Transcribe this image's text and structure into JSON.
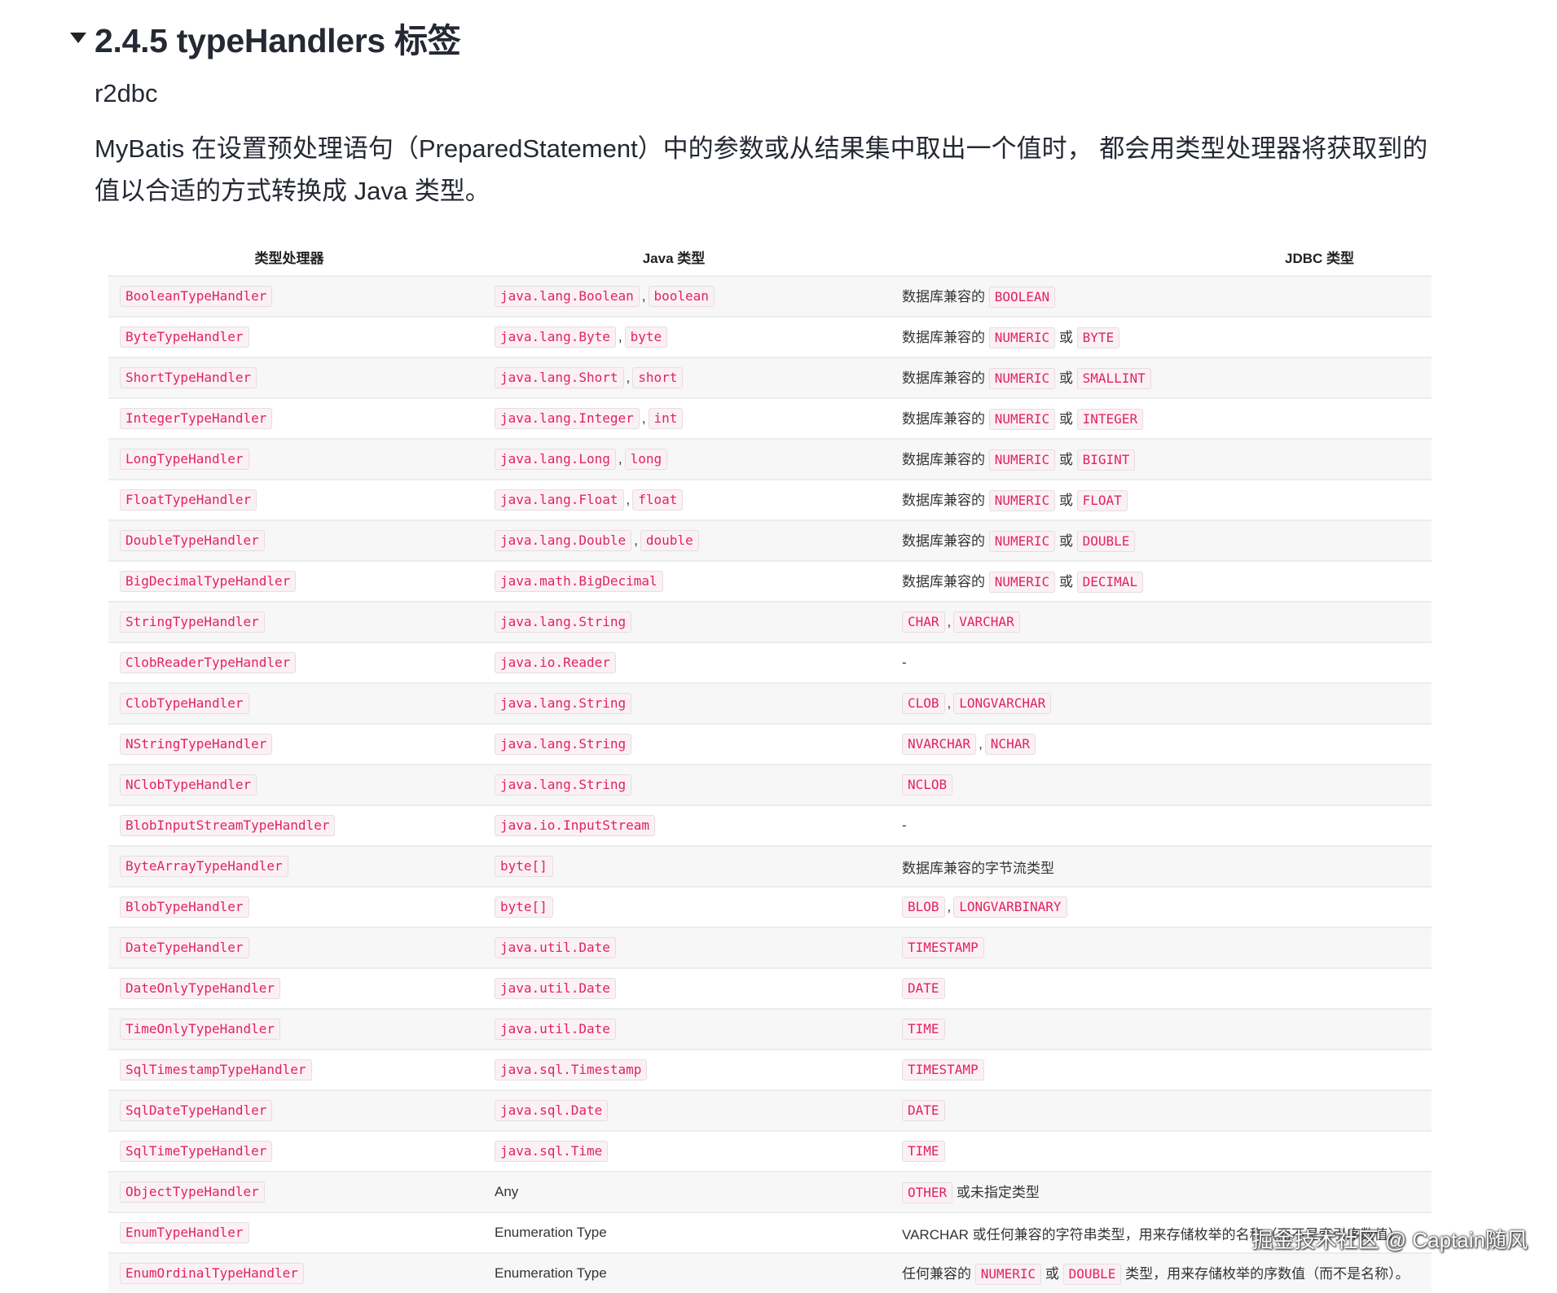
{
  "heading": {
    "title": "2.4.5 typeHandlers 标签"
  },
  "paragraphs": [
    "r2dbc",
    "MyBatis 在设置预处理语句（PreparedStatement）中的参数或从结果集中取出一个值时， 都会用类型处理器将获取到的值以合适的方式转换成 Java 类型。"
  ],
  "table": {
    "headers": [
      "类型处理器",
      "Java 类型",
      "JDBC 类型"
    ],
    "rows": [
      {
        "handler": "BooleanTypeHandler",
        "java": [
          [
            "code",
            "java.lang.Boolean"
          ],
          [
            "sep",
            ","
          ],
          [
            "code",
            "boolean"
          ]
        ],
        "jdbc": [
          [
            "text",
            "数据库兼容的"
          ],
          [
            "code",
            "BOOLEAN"
          ]
        ]
      },
      {
        "handler": "ByteTypeHandler",
        "java": [
          [
            "code",
            "java.lang.Byte"
          ],
          [
            "sep",
            ","
          ],
          [
            "code",
            "byte"
          ]
        ],
        "jdbc": [
          [
            "text",
            "数据库兼容的"
          ],
          [
            "code",
            "NUMERIC"
          ],
          [
            "text",
            "或"
          ],
          [
            "code",
            "BYTE"
          ]
        ]
      },
      {
        "handler": "ShortTypeHandler",
        "java": [
          [
            "code",
            "java.lang.Short"
          ],
          [
            "sep",
            ","
          ],
          [
            "code",
            "short"
          ]
        ],
        "jdbc": [
          [
            "text",
            "数据库兼容的"
          ],
          [
            "code",
            "NUMERIC"
          ],
          [
            "text",
            "或"
          ],
          [
            "code",
            "SMALLINT"
          ]
        ]
      },
      {
        "handler": "IntegerTypeHandler",
        "java": [
          [
            "code",
            "java.lang.Integer"
          ],
          [
            "sep",
            ","
          ],
          [
            "code",
            "int"
          ]
        ],
        "jdbc": [
          [
            "text",
            "数据库兼容的"
          ],
          [
            "code",
            "NUMERIC"
          ],
          [
            "text",
            "或"
          ],
          [
            "code",
            "INTEGER"
          ]
        ]
      },
      {
        "handler": "LongTypeHandler",
        "java": [
          [
            "code",
            "java.lang.Long"
          ],
          [
            "sep",
            ","
          ],
          [
            "code",
            "long"
          ]
        ],
        "jdbc": [
          [
            "text",
            "数据库兼容的"
          ],
          [
            "code",
            "NUMERIC"
          ],
          [
            "text",
            "或"
          ],
          [
            "code",
            "BIGINT"
          ]
        ]
      },
      {
        "handler": "FloatTypeHandler",
        "java": [
          [
            "code",
            "java.lang.Float"
          ],
          [
            "sep",
            ","
          ],
          [
            "code",
            "float"
          ]
        ],
        "jdbc": [
          [
            "text",
            "数据库兼容的"
          ],
          [
            "code",
            "NUMERIC"
          ],
          [
            "text",
            "或"
          ],
          [
            "code",
            "FLOAT"
          ]
        ]
      },
      {
        "handler": "DoubleTypeHandler",
        "java": [
          [
            "code",
            "java.lang.Double"
          ],
          [
            "sep",
            ","
          ],
          [
            "code",
            "double"
          ]
        ],
        "jdbc": [
          [
            "text",
            "数据库兼容的"
          ],
          [
            "code",
            "NUMERIC"
          ],
          [
            "text",
            "或"
          ],
          [
            "code",
            "DOUBLE"
          ]
        ]
      },
      {
        "handler": "BigDecimalTypeHandler",
        "java": [
          [
            "code",
            "java.math.BigDecimal"
          ]
        ],
        "jdbc": [
          [
            "text",
            "数据库兼容的"
          ],
          [
            "code",
            "NUMERIC"
          ],
          [
            "text",
            "或"
          ],
          [
            "code",
            "DECIMAL"
          ]
        ]
      },
      {
        "handler": "StringTypeHandler",
        "java": [
          [
            "code",
            "java.lang.String"
          ]
        ],
        "jdbc": [
          [
            "code",
            "CHAR"
          ],
          [
            "sep",
            ","
          ],
          [
            "code",
            "VARCHAR"
          ]
        ]
      },
      {
        "handler": "ClobReaderTypeHandler",
        "java": [
          [
            "code",
            "java.io.Reader"
          ]
        ],
        "jdbc": [
          [
            "text",
            "-"
          ]
        ]
      },
      {
        "handler": "ClobTypeHandler",
        "java": [
          [
            "code",
            "java.lang.String"
          ]
        ],
        "jdbc": [
          [
            "code",
            "CLOB"
          ],
          [
            "sep",
            ","
          ],
          [
            "code",
            "LONGVARCHAR"
          ]
        ]
      },
      {
        "handler": "NStringTypeHandler",
        "java": [
          [
            "code",
            "java.lang.String"
          ]
        ],
        "jdbc": [
          [
            "code",
            "NVARCHAR"
          ],
          [
            "sep",
            ","
          ],
          [
            "code",
            "NCHAR"
          ]
        ]
      },
      {
        "handler": "NClobTypeHandler",
        "java": [
          [
            "code",
            "java.lang.String"
          ]
        ],
        "jdbc": [
          [
            "code",
            "NCLOB"
          ]
        ]
      },
      {
        "handler": "BlobInputStreamTypeHandler",
        "java": [
          [
            "code",
            "java.io.InputStream"
          ]
        ],
        "jdbc": [
          [
            "text",
            "-"
          ]
        ]
      },
      {
        "handler": "ByteArrayTypeHandler",
        "java": [
          [
            "code",
            "byte[]"
          ]
        ],
        "jdbc": [
          [
            "text",
            "数据库兼容的字节流类型"
          ]
        ]
      },
      {
        "handler": "BlobTypeHandler",
        "java": [
          [
            "code",
            "byte[]"
          ]
        ],
        "jdbc": [
          [
            "code",
            "BLOB"
          ],
          [
            "sep",
            ","
          ],
          [
            "code",
            "LONGVARBINARY"
          ]
        ]
      },
      {
        "handler": "DateTypeHandler",
        "java": [
          [
            "code",
            "java.util.Date"
          ]
        ],
        "jdbc": [
          [
            "code",
            "TIMESTAMP"
          ]
        ]
      },
      {
        "handler": "DateOnlyTypeHandler",
        "java": [
          [
            "code",
            "java.util.Date"
          ]
        ],
        "jdbc": [
          [
            "code",
            "DATE"
          ]
        ]
      },
      {
        "handler": "TimeOnlyTypeHandler",
        "java": [
          [
            "code",
            "java.util.Date"
          ]
        ],
        "jdbc": [
          [
            "code",
            "TIME"
          ]
        ]
      },
      {
        "handler": "SqlTimestampTypeHandler",
        "java": [
          [
            "code",
            "java.sql.Timestamp"
          ]
        ],
        "jdbc": [
          [
            "code",
            "TIMESTAMP"
          ]
        ]
      },
      {
        "handler": "SqlDateTypeHandler",
        "java": [
          [
            "code",
            "java.sql.Date"
          ]
        ],
        "jdbc": [
          [
            "code",
            "DATE"
          ]
        ]
      },
      {
        "handler": "SqlTimeTypeHandler",
        "java": [
          [
            "code",
            "java.sql.Time"
          ]
        ],
        "jdbc": [
          [
            "code",
            "TIME"
          ]
        ]
      },
      {
        "handler": "ObjectTypeHandler",
        "java": [
          [
            "text",
            "Any"
          ]
        ],
        "jdbc": [
          [
            "code",
            "OTHER"
          ],
          [
            "text",
            "或未指定类型"
          ]
        ]
      },
      {
        "handler": "EnumTypeHandler",
        "java": [
          [
            "text",
            "Enumeration Type"
          ]
        ],
        "jdbc": [
          [
            "text",
            "VARCHAR 或任何兼容的字符串类型，用来存储枚举的名称（而不是索引序数值）"
          ]
        ]
      },
      {
        "handler": "EnumOrdinalTypeHandler",
        "java": [
          [
            "text",
            "Enumeration Type"
          ]
        ],
        "jdbc": [
          [
            "text",
            "任何兼容的"
          ],
          [
            "code",
            "NUMERIC"
          ],
          [
            "text",
            "或"
          ],
          [
            "code",
            "DOUBLE"
          ],
          [
            "text",
            "类型，用来存储枚举的序数值（而不是名称）。"
          ]
        ]
      }
    ]
  },
  "credit": "掘金技术社区 @ Captain随风"
}
